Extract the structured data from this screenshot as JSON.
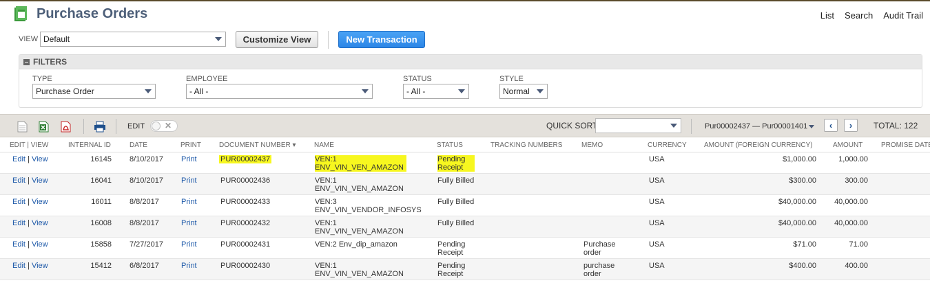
{
  "header": {
    "title": "Purchase Orders",
    "links": [
      "List",
      "Search",
      "Audit Trail"
    ]
  },
  "view": {
    "label": "VIEW",
    "value": "Default",
    "customize_label": "Customize View",
    "new_transaction_label": "New Transaction"
  },
  "filters": {
    "heading": "FILTERS",
    "type_label": "TYPE",
    "type_value": "Purchase Order",
    "employee_label": "EMPLOYEE",
    "employee_value": "- All -",
    "status_label": "STATUS",
    "status_value": "- All -",
    "style_label": "STYLE",
    "style_value": "Normal"
  },
  "toolbar": {
    "edit_label": "EDIT",
    "quick_sort_label": "QUICK SORT",
    "quick_sort_value": "",
    "range_label": "Pur00002437 — Pur00001401",
    "total_label": "TOTAL: 122"
  },
  "columns": [
    "EDIT | VIEW",
    "INTERNAL ID",
    "DATE",
    "PRINT",
    "DOCUMENT NUMBER ▾",
    "NAME",
    "STATUS",
    "TRACKING NUMBERS",
    "MEMO",
    "CURRENCY",
    "AMOUNT (FOREIGN CURRENCY)",
    "AMOUNT",
    "PROMISE DATE"
  ],
  "rows": [
    {
      "edit": "Edit",
      "sep": "|",
      "view": "View",
      "id": "16145",
      "date": "8/10/2017",
      "print": "Print",
      "doc": "PUR00002437",
      "name1": "VEN:1",
      "name2": "ENV_VIN_VEN_AMAZON",
      "status1": "Pending",
      "status2": "Receipt",
      "memo1": "",
      "memo2": "",
      "currency": "USA",
      "amount_fc": "$1,000.00",
      "amount": "1,000.00"
    },
    {
      "edit": "Edit",
      "sep": "|",
      "view": "View",
      "id": "16041",
      "date": "8/10/2017",
      "print": "Print",
      "doc": "PUR00002436",
      "name1": "VEN:1",
      "name2": "ENV_VIN_VEN_AMAZON",
      "status1": "Fully Billed",
      "status2": "",
      "memo1": "",
      "memo2": "",
      "currency": "USA",
      "amount_fc": "$300.00",
      "amount": "300.00"
    },
    {
      "edit": "Edit",
      "sep": "|",
      "view": "View",
      "id": "16011",
      "date": "8/8/2017",
      "print": "Print",
      "doc": "PUR00002433",
      "name1": "VEN:3",
      "name2": "ENV_VIN_VENDOR_INFOSYS",
      "status1": "Fully Billed",
      "status2": "",
      "memo1": "",
      "memo2": "",
      "currency": "USA",
      "amount_fc": "$40,000.00",
      "amount": "40,000.00"
    },
    {
      "edit": "Edit",
      "sep": "|",
      "view": "View",
      "id": "16008",
      "date": "8/8/2017",
      "print": "Print",
      "doc": "PUR00002432",
      "name1": "VEN:1",
      "name2": "ENV_VIN_VEN_AMAZON",
      "status1": "Fully Billed",
      "status2": "",
      "memo1": "",
      "memo2": "",
      "currency": "USA",
      "amount_fc": "$40,000.00",
      "amount": "40,000.00"
    },
    {
      "edit": "Edit",
      "sep": "|",
      "view": "View",
      "id": "15858",
      "date": "7/27/2017",
      "print": "Print",
      "doc": "PUR00002431",
      "name1": "VEN:2 Env_dip_amazon",
      "name2": "",
      "status1": "Pending",
      "status2": "Receipt",
      "memo1": "Purchase",
      "memo2": "order",
      "currency": "USA",
      "amount_fc": "$71.00",
      "amount": "71.00"
    },
    {
      "edit": "Edit",
      "sep": "|",
      "view": "View",
      "id": "15412",
      "date": "6/8/2017",
      "print": "Print",
      "doc": "PUR00002430",
      "name1": "VEN:1",
      "name2": "ENV_VIN_VEN_AMAZON",
      "status1": "Pending",
      "status2": "Receipt",
      "memo1": "purchase",
      "memo2": "order",
      "currency": "USA",
      "amount_fc": "$400.00",
      "amount": "400.00"
    }
  ]
}
